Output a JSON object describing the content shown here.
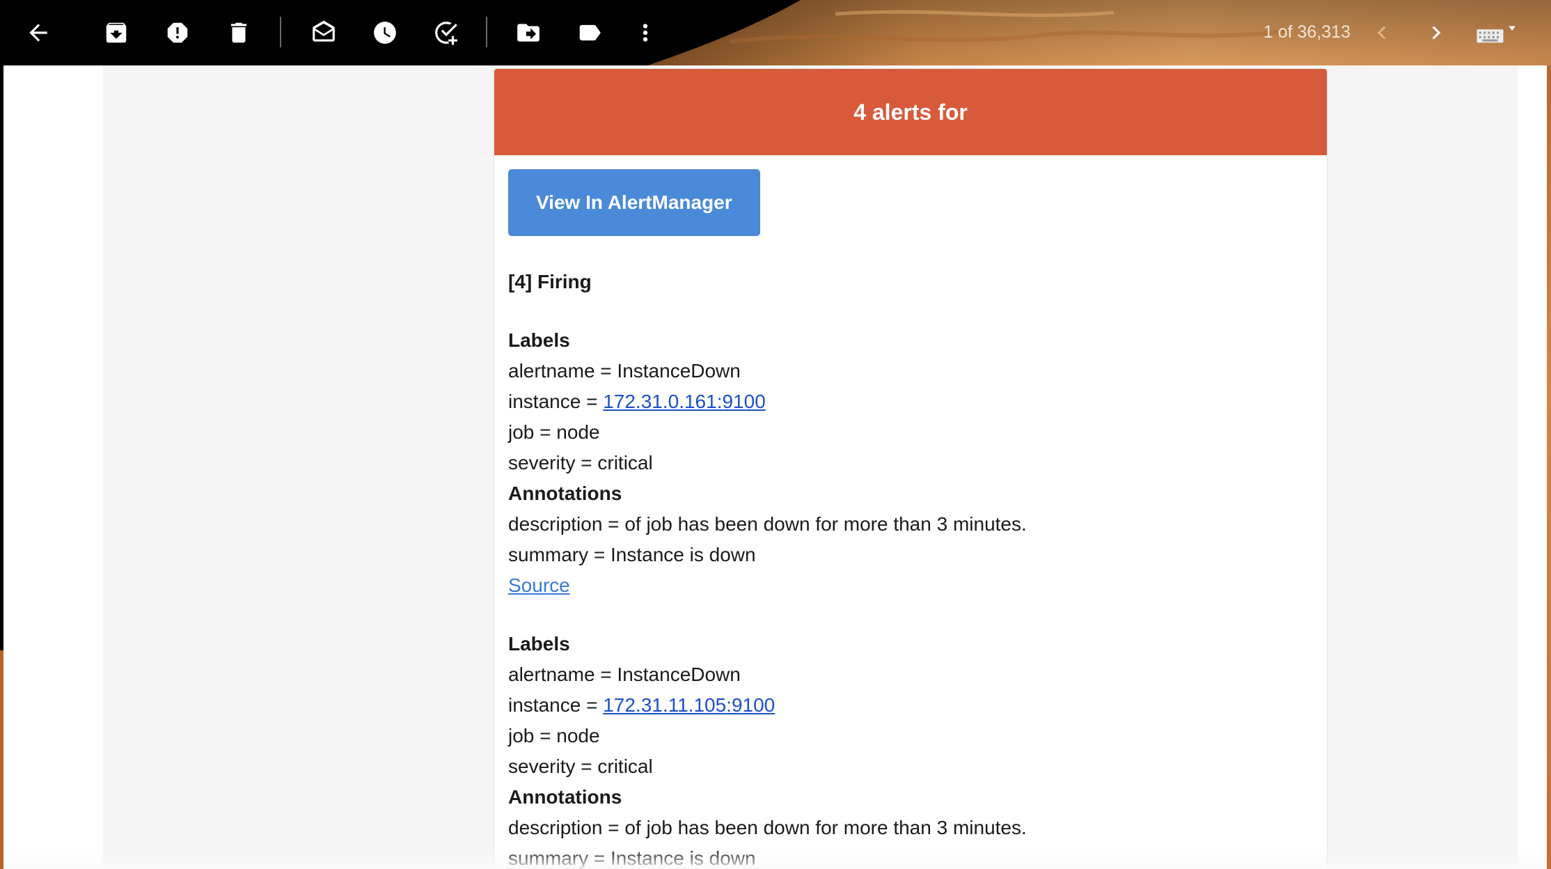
{
  "toolbar": {
    "buttons": [
      {
        "name": "back",
        "icon": "arrow-left-icon"
      },
      {
        "name": "archive",
        "icon": "archive-icon"
      },
      {
        "name": "report-spam",
        "icon": "report-spam-icon"
      },
      {
        "name": "delete",
        "icon": "trash-icon"
      },
      {
        "name": "mark-unread",
        "icon": "mark-unread-icon"
      },
      {
        "name": "snooze",
        "icon": "clock-icon"
      },
      {
        "name": "add-to-tasks",
        "icon": "add-task-icon"
      },
      {
        "name": "move-to",
        "icon": "move-to-icon"
      },
      {
        "name": "labels",
        "icon": "label-icon"
      },
      {
        "name": "more",
        "icon": "more-vert-icon"
      }
    ],
    "pager": "1 of 36,313",
    "colors": {
      "background": "#000000",
      "icon": "#ffffff"
    }
  },
  "email": {
    "header_title": "4 alerts for",
    "view_button_label": "View In AlertManager",
    "firing_heading": "[4] Firing",
    "alerts": [
      {
        "labels_heading": "Labels",
        "alertname": "alertname = InstanceDown",
        "instance_prefix": "instance = ",
        "instance_link": "172.31.0.161:9100",
        "job": "job = node",
        "severity": "severity = critical",
        "annotations_heading": "Annotations",
        "description": "description = of job has been down for more than 3 minutes.",
        "summary": "summary = Instance is down",
        "source_link": "Source"
      },
      {
        "labels_heading": "Labels",
        "alertname": "alertname = InstanceDown",
        "instance_prefix": "instance = ",
        "instance_link": "172.31.11.105:9100",
        "job": "job = node",
        "severity": "severity = critical",
        "annotations_heading": "Annotations",
        "description": "description = of job has been down for more than 3 minutes.",
        "summary": "summary = Instance is down"
      }
    ],
    "colors": {
      "header": "#d75a3a",
      "button": "#4a8ad8",
      "link": "#1b4fc9"
    }
  }
}
